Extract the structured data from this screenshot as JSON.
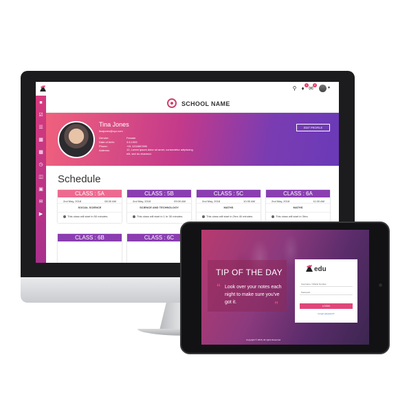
{
  "desktop": {
    "topbar": {
      "notif_count_1": "1",
      "notif_count_2": "2",
      "notif_count_3": "3"
    },
    "school_name": "SCHOOL NAME",
    "profile": {
      "name": "Tina Jones",
      "email": "tinajones@xyz.com",
      "rows": [
        {
          "label": "Gender:",
          "value": "Female"
        },
        {
          "label": "Date of birth:",
          "value": "3.6.1993"
        },
        {
          "label": "Phone:",
          "value": "+91 1234567890"
        },
        {
          "label": "Address:",
          "value": "12, Lorem ipsum dolor sit amet, consectetur adipiscing elit, sed do eiusmod."
        }
      ],
      "edit_label": "EDIT PROFILE"
    },
    "schedule": {
      "title": "Schedule",
      "cards": [
        {
          "class": "CLASS : 5A",
          "date": "2nd May, 2018",
          "time": "08:30 AM",
          "subject": "SOCIAL SCIENCE",
          "note": "This class will start in 50 minutes.",
          "color": "#ec6a8f"
        },
        {
          "class": "CLASS : 5B",
          "date": "2nd May, 2018",
          "time": "09:00 AM",
          "subject": "SCIENCE AND TECHNOLOGY",
          "note": "This class will start in 1 hr 30 minutes.",
          "color": "#8a3eb0"
        },
        {
          "class": "CLASS : 5C",
          "date": "2nd May, 2018",
          "time": "10:30 AM",
          "subject": "MATHS",
          "note": "This class will start in 2hrs 40 minutes.",
          "color": "#8a3eb0"
        },
        {
          "class": "CLASS : 6A",
          "date": "2nd May, 2018",
          "time": "11:00 AM",
          "subject": "MATHS",
          "note": "This class will start in 3hrs.",
          "color": "#8a3eb0"
        },
        {
          "class": "CLASS : 6B",
          "date": "",
          "time": "",
          "subject": "",
          "note": "",
          "color": "#8a3eb0"
        },
        {
          "class": "CLASS : 6C",
          "date": "",
          "time": "",
          "subject": "",
          "note": "",
          "color": "#8a3eb0"
        }
      ]
    }
  },
  "tablet": {
    "tip_title": "TIP OF THE DAY",
    "tip_text": "Look over your notes each night to make sure you've got it.",
    "brand": "edu",
    "username_placeholder": "Username / Mobile Number",
    "password_placeholder": "Password",
    "login_label": "LOGIN",
    "forgot_label": "Forgot password?",
    "copyright": "Copyright © 2018, All rights Reserved"
  }
}
